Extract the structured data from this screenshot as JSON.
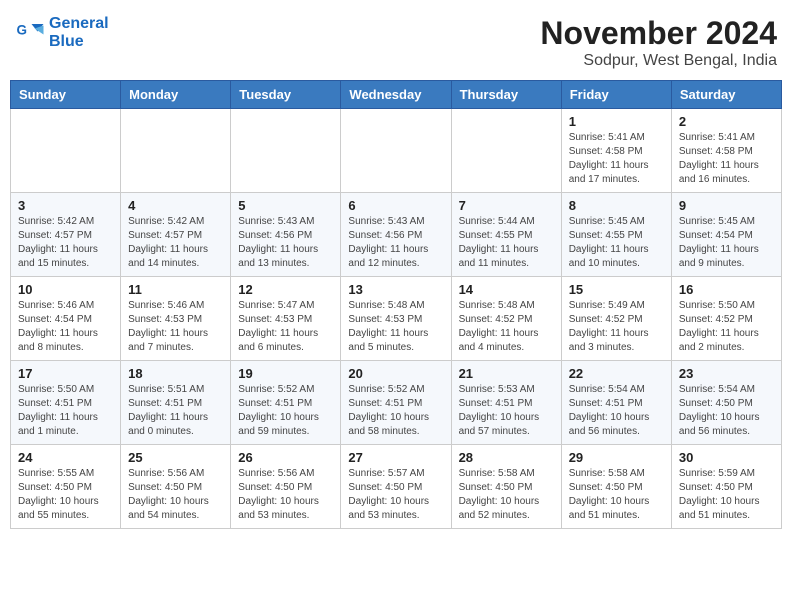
{
  "logo": {
    "line1": "General",
    "line2": "Blue"
  },
  "title": "November 2024",
  "location": "Sodpur, West Bengal, India",
  "days_of_week": [
    "Sunday",
    "Monday",
    "Tuesday",
    "Wednesday",
    "Thursday",
    "Friday",
    "Saturday"
  ],
  "weeks": [
    [
      {
        "day": "",
        "info": ""
      },
      {
        "day": "",
        "info": ""
      },
      {
        "day": "",
        "info": ""
      },
      {
        "day": "",
        "info": ""
      },
      {
        "day": "",
        "info": ""
      },
      {
        "day": "1",
        "info": "Sunrise: 5:41 AM\nSunset: 4:58 PM\nDaylight: 11 hours and 17 minutes."
      },
      {
        "day": "2",
        "info": "Sunrise: 5:41 AM\nSunset: 4:58 PM\nDaylight: 11 hours and 16 minutes."
      }
    ],
    [
      {
        "day": "3",
        "info": "Sunrise: 5:42 AM\nSunset: 4:57 PM\nDaylight: 11 hours and 15 minutes."
      },
      {
        "day": "4",
        "info": "Sunrise: 5:42 AM\nSunset: 4:57 PM\nDaylight: 11 hours and 14 minutes."
      },
      {
        "day": "5",
        "info": "Sunrise: 5:43 AM\nSunset: 4:56 PM\nDaylight: 11 hours and 13 minutes."
      },
      {
        "day": "6",
        "info": "Sunrise: 5:43 AM\nSunset: 4:56 PM\nDaylight: 11 hours and 12 minutes."
      },
      {
        "day": "7",
        "info": "Sunrise: 5:44 AM\nSunset: 4:55 PM\nDaylight: 11 hours and 11 minutes."
      },
      {
        "day": "8",
        "info": "Sunrise: 5:45 AM\nSunset: 4:55 PM\nDaylight: 11 hours and 10 minutes."
      },
      {
        "day": "9",
        "info": "Sunrise: 5:45 AM\nSunset: 4:54 PM\nDaylight: 11 hours and 9 minutes."
      }
    ],
    [
      {
        "day": "10",
        "info": "Sunrise: 5:46 AM\nSunset: 4:54 PM\nDaylight: 11 hours and 8 minutes."
      },
      {
        "day": "11",
        "info": "Sunrise: 5:46 AM\nSunset: 4:53 PM\nDaylight: 11 hours and 7 minutes."
      },
      {
        "day": "12",
        "info": "Sunrise: 5:47 AM\nSunset: 4:53 PM\nDaylight: 11 hours and 6 minutes."
      },
      {
        "day": "13",
        "info": "Sunrise: 5:48 AM\nSunset: 4:53 PM\nDaylight: 11 hours and 5 minutes."
      },
      {
        "day": "14",
        "info": "Sunrise: 5:48 AM\nSunset: 4:52 PM\nDaylight: 11 hours and 4 minutes."
      },
      {
        "day": "15",
        "info": "Sunrise: 5:49 AM\nSunset: 4:52 PM\nDaylight: 11 hours and 3 minutes."
      },
      {
        "day": "16",
        "info": "Sunrise: 5:50 AM\nSunset: 4:52 PM\nDaylight: 11 hours and 2 minutes."
      }
    ],
    [
      {
        "day": "17",
        "info": "Sunrise: 5:50 AM\nSunset: 4:51 PM\nDaylight: 11 hours and 1 minute."
      },
      {
        "day": "18",
        "info": "Sunrise: 5:51 AM\nSunset: 4:51 PM\nDaylight: 11 hours and 0 minutes."
      },
      {
        "day": "19",
        "info": "Sunrise: 5:52 AM\nSunset: 4:51 PM\nDaylight: 10 hours and 59 minutes."
      },
      {
        "day": "20",
        "info": "Sunrise: 5:52 AM\nSunset: 4:51 PM\nDaylight: 10 hours and 58 minutes."
      },
      {
        "day": "21",
        "info": "Sunrise: 5:53 AM\nSunset: 4:51 PM\nDaylight: 10 hours and 57 minutes."
      },
      {
        "day": "22",
        "info": "Sunrise: 5:54 AM\nSunset: 4:51 PM\nDaylight: 10 hours and 56 minutes."
      },
      {
        "day": "23",
        "info": "Sunrise: 5:54 AM\nSunset: 4:50 PM\nDaylight: 10 hours and 56 minutes."
      }
    ],
    [
      {
        "day": "24",
        "info": "Sunrise: 5:55 AM\nSunset: 4:50 PM\nDaylight: 10 hours and 55 minutes."
      },
      {
        "day": "25",
        "info": "Sunrise: 5:56 AM\nSunset: 4:50 PM\nDaylight: 10 hours and 54 minutes."
      },
      {
        "day": "26",
        "info": "Sunrise: 5:56 AM\nSunset: 4:50 PM\nDaylight: 10 hours and 53 minutes."
      },
      {
        "day": "27",
        "info": "Sunrise: 5:57 AM\nSunset: 4:50 PM\nDaylight: 10 hours and 53 minutes."
      },
      {
        "day": "28",
        "info": "Sunrise: 5:58 AM\nSunset: 4:50 PM\nDaylight: 10 hours and 52 minutes."
      },
      {
        "day": "29",
        "info": "Sunrise: 5:58 AM\nSunset: 4:50 PM\nDaylight: 10 hours and 51 minutes."
      },
      {
        "day": "30",
        "info": "Sunrise: 5:59 AM\nSunset: 4:50 PM\nDaylight: 10 hours and 51 minutes."
      }
    ]
  ]
}
